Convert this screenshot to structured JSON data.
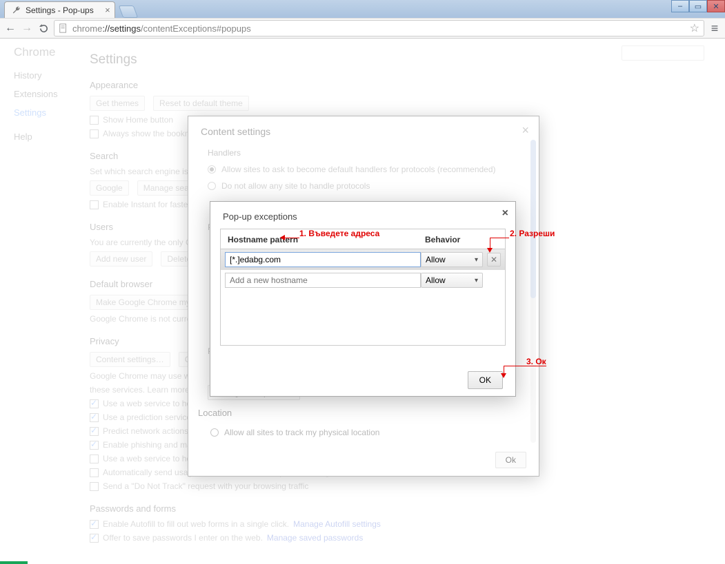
{
  "window": {
    "tab_title": "Settings - Pop-ups"
  },
  "nav": {
    "url_scheme": "chrome",
    "url_host": "://settings",
    "url_path": "/contentExceptions#popups"
  },
  "bg": {
    "brand": "Chrome",
    "sidebar": [
      "History",
      "Extensions",
      "Settings",
      "Help"
    ],
    "heading": "Settings",
    "appearance": {
      "title": "Appearance",
      "get_themes": "Get themes",
      "reset": "Reset to default theme",
      "show_home": "Show Home button",
      "show_bookmarks": "Always show the bookmarks bar"
    },
    "search": {
      "title": "Search",
      "desc": "Set which search engine is used when searching from the omnibox.",
      "engine": "Google",
      "manage": "Manage search engines…",
      "instant": "Enable Instant for faster searching"
    },
    "users": {
      "title": "Users",
      "desc": "You are currently the only Google Chrome user.",
      "add": "Add new user",
      "delete": "Delete this user"
    },
    "default_browser": {
      "title": "Default browser",
      "btn": "Make Google Chrome my default browser",
      "status": "Google Chrome is not currently your default browser."
    },
    "privacy": {
      "title": "Privacy",
      "content_btn": "Content settings…",
      "clear_btn": "Clear browsing data…",
      "desc1": "Google Chrome may use web services to improve your browsing experience. You may optionally disable",
      "desc2": "these services. Learn more",
      "opts": [
        "Use a web service to help resolve navigation errors",
        "Use a prediction service to help complete searches and URLs typed in the address bar",
        "Predict network actions to improve page load performance",
        "Enable phishing and malware protection",
        "Use a web service to help resolve spelling errors",
        "Automatically send usage statistics and crash reports to Google",
        "Send a \"Do Not Track\" request with your browsing traffic"
      ]
    },
    "passwords": {
      "title": "Passwords and forms",
      "opt1": "Enable Autofill to fill out web forms in a single click.",
      "opt1_link": "Manage Autofill settings",
      "opt2": "Offer to save passwords I enter on the web.",
      "opt2_link": "Manage saved passwords"
    }
  },
  "modal1": {
    "title": "Content settings",
    "handlers_title": "Handlers",
    "handlers_opt1": "Allow sites to ask to become default handlers for protocols (recommended)",
    "handlers_opt2": "Do not allow any site to handle protocols",
    "plugins_title": "Plug-ins",
    "popups_title": "Pop-ups",
    "manage_exceptions": "Manage exceptions…",
    "location_title": "Location",
    "location_opt": "Allow all sites to track my physical location",
    "ok": "Ok"
  },
  "modal2": {
    "title": "Pop-up exceptions",
    "col_host": "Hostname pattern",
    "col_beh": "Behavior",
    "rows": [
      {
        "host": "[*.]edabg.com",
        "behavior": "Allow"
      }
    ],
    "placeholder": "Add a new hostname",
    "placeholder_beh": "Allow",
    "ok": "OK"
  },
  "annotations": {
    "a1": "1. Въведете адреса",
    "a2": "2. Разреши",
    "a3": "3. Ок"
  }
}
